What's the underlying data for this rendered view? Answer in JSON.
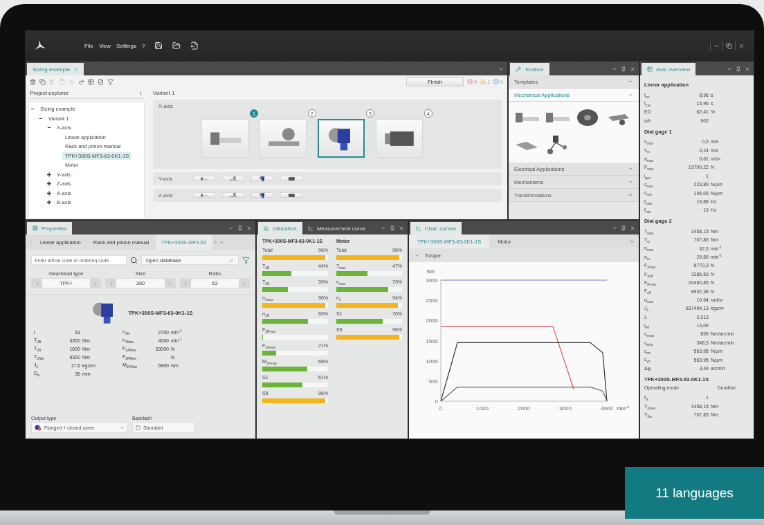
{
  "menu": [
    "File",
    "View",
    "Settings",
    "?"
  ],
  "sizing": {
    "tab": "Sizing example",
    "finish": "Finish",
    "counters": [
      {
        "kind": "error",
        "count": "0"
      },
      {
        "kind": "warning",
        "count": "1"
      },
      {
        "kind": "info",
        "count": "0"
      }
    ],
    "explorer_title": "Project explorer",
    "tree": [
      {
        "label": "Sizing example",
        "selected": false,
        "expanded": true,
        "children": [
          {
            "label": "Variant 1",
            "selected": false,
            "expanded": true,
            "children": [
              {
                "label": "X-axis",
                "selected": false,
                "expanded": true,
                "children": [
                  {
                    "label": "Linear application",
                    "selected": false
                  },
                  {
                    "label": "Rack and pinion manual",
                    "selected": false
                  },
                  {
                    "label": "TPK+300S-MF3-63-0K1-1S",
                    "selected": true
                  },
                  {
                    "label": "Motor",
                    "selected": false
                  }
                ]
              },
              {
                "label": "Y-axis",
                "selected": false,
                "expanded": false
              },
              {
                "label": "Z-axis",
                "selected": false,
                "expanded": false
              },
              {
                "label": "A-axis",
                "selected": false,
                "expanded": false
              },
              {
                "label": "B-axis",
                "selected": false,
                "expanded": false
              }
            ]
          }
        ]
      }
    ],
    "variant": "Variant 1",
    "axes": [
      {
        "label": "X-axis",
        "expanded": true,
        "components": [
          {
            "kind": "linear",
            "selected": false,
            "marker": "1",
            "marker_active": true
          },
          {
            "kind": "rack",
            "selected": false,
            "marker": "2",
            "marker_active": false
          },
          {
            "kind": "gearbox",
            "selected": true,
            "marker": "3",
            "marker_active": false
          },
          {
            "kind": "motor",
            "selected": false,
            "marker": "4",
            "marker_active": false
          }
        ]
      },
      {
        "label": "Y-axis",
        "expanded": false,
        "components": [
          {
            "kind": "linear",
            "selected": false
          },
          {
            "kind": "rack",
            "selected": false
          },
          {
            "kind": "gearbox",
            "selected": false
          },
          {
            "kind": "motor",
            "selected": false
          }
        ]
      },
      {
        "label": "Z-axis",
        "expanded": false,
        "components": [
          {
            "kind": "linear",
            "selected": false
          },
          {
            "kind": "rack",
            "selected": false
          },
          {
            "kind": "gearbox",
            "selected": false
          },
          {
            "kind": "motor",
            "selected": false
          }
        ]
      }
    ]
  },
  "toolbox": {
    "title": "Toolbox",
    "sections": [
      {
        "label": "Templates",
        "expanded": false
      },
      {
        "label": "Mechanical Applications",
        "expanded": true,
        "items": [
          {
            "kind": "linear"
          },
          {
            "kind": "linear"
          },
          {
            "kind": "fan"
          },
          {
            "kind": "arm"
          },
          {
            "kind": "chain"
          },
          {
            "kind": "network"
          }
        ]
      },
      {
        "label": "Electrical Applications",
        "expanded": false
      },
      {
        "label": "Mechanisms",
        "expanded": false
      },
      {
        "label": "Transformations",
        "expanded": false
      }
    ]
  },
  "properties": {
    "title": "Properties",
    "tabs": [
      {
        "label": "Linear application",
        "selected": false
      },
      {
        "label": "Rack and pinion manual",
        "selected": false
      },
      {
        "label": "TPK+300S-MF3-63",
        "selected": true
      }
    ],
    "search": {
      "placeholder": "Enter article code or ordering code"
    },
    "database": "Open database",
    "selectors": [
      {
        "label": "Gearhead type",
        "value": "TPK+"
      },
      {
        "label": "Size",
        "value": "300"
      },
      {
        "label": "Ratio",
        "value": "63"
      }
    ],
    "product": "TPK+300S-MF3-63-0K1-1S",
    "specs_left": [
      {
        "label": "i",
        "value": "63"
      },
      {
        "label": "T$_{2B}$",
        "value": "3300",
        "unit": "Nm"
      },
      {
        "label": "T$_{2N}$",
        "value": "1600",
        "unit": "Nm"
      },
      {
        "label": "T$_{2Not}$",
        "value": "6300",
        "unit": "Nm"
      },
      {
        "label": "J$_{1}$",
        "value": "17,6",
        "unit": "kgcm²"
      },
      {
        "label": "D$_{a}$",
        "value": "36",
        "unit": "mm"
      }
    ],
    "specs_right": [
      {
        "label": "n$_{1N}$",
        "value": "2700",
        "unit": "min$^{-1}$"
      },
      {
        "label": "n$_{1Max}$",
        "value": "4000",
        "unit": "min$^{-1}$"
      },
      {
        "label": "F$_{2AMax}$",
        "value": "33000",
        "unit": "N"
      },
      {
        "label": "F$_{2RMax}$",
        "unit": "N"
      },
      {
        "label": "M$_{2KMax}$",
        "value": "5900",
        "unit": "Nm"
      }
    ],
    "output_type": {
      "label": "Output type",
      "value": "Flanged + closed cover"
    },
    "backlash": {
      "label": "Backlash",
      "value": "Standard"
    }
  },
  "utilization": {
    "tabs": [
      {
        "label": "Utilization",
        "selected": true,
        "kind": "bars"
      },
      {
        "label": "Measurement curve",
        "selected": false,
        "kind": "curve"
      }
    ],
    "columns": [
      {
        "title": "TPK+300S-MF3-63-0K1-1S",
        "items": [
          {
            "label": "Total",
            "reading": "96%",
            "level": 0.96
          },
          {
            "label": "T$_{2B}$",
            "reading": "44%",
            "level": 0.44
          },
          {
            "label": "T$_{2N}$",
            "reading": "39%",
            "level": 0.39
          },
          {
            "label": "n$_{1max}$",
            "reading": "96%",
            "level": 0.96
          },
          {
            "label": "n$_{1N}$",
            "reading": "69%",
            "level": 0.69
          },
          {
            "label": "F$_{2Rmax}$",
            "level": 0
          },
          {
            "label": "F$_{2Amax}$",
            "reading": "21%",
            "level": 0.21
          },
          {
            "label": "M$_{2Kmax}$",
            "reading": "68%",
            "level": 0.68
          },
          {
            "label": "S1",
            "reading": "61%",
            "level": 0.61
          },
          {
            "label": "S5",
            "reading": "96%",
            "level": 0.96
          }
        ]
      },
      {
        "title": "Motor",
        "items": [
          {
            "label": "Total",
            "reading": "96%",
            "level": 0.96
          },
          {
            "label": "T$_{max}$",
            "reading": "47%",
            "level": 0.47
          },
          {
            "label": "n$_{max}$",
            "reading": "79%",
            "level": 0.79
          },
          {
            "label": "n$_{1}$",
            "reading": "94%",
            "level": 0.94
          },
          {
            "label": "S1",
            "reading": "70%",
            "level": 0.7
          },
          {
            "label": "S5",
            "reading": "96%",
            "level": 0.96
          }
        ]
      }
    ]
  },
  "curves": {
    "title": "Char. curves",
    "tabs": [
      {
        "label": "TPK+300S-MF3-63-0K1-1S",
        "selected": true
      },
      {
        "label": "Motor",
        "selected": false
      }
    ],
    "section": {
      "label": "Torque",
      "expanded": true
    },
    "chart_data": {
      "type": "line",
      "ylabel": "Nm",
      "xlabel": "min$^{-1}$",
      "x": [
        0,
        400,
        650,
        2700,
        3200,
        3600,
        3900,
        4000
      ],
      "series": [
        {
          "color": "#7b7bd6",
          "values": [
            3000,
            3000,
            3000,
            3000,
            3000,
            3000,
            3000,
            3000
          ]
        },
        {
          "color": "#e05050",
          "values": [
            1850,
            1850,
            1850,
            1850,
            300,
            null,
            null,
            null
          ]
        },
        {
          "color": "#333333",
          "values": [
            0,
            1450,
            1450,
            1450,
            1450,
            1450,
            1200,
            0
          ]
        },
        {
          "color": "#666666",
          "values": [
            0,
            350,
            350,
            350,
            350,
            350,
            250,
            0
          ]
        }
      ],
      "xlim": [
        0,
        4000
      ],
      "ylim": [
        0,
        3000
      ],
      "xticks": [
        0,
        1000,
        2000,
        3000,
        4000
      ],
      "yticks": [
        0,
        500,
        1000,
        1500,
        2000,
        2500,
        3000
      ]
    }
  },
  "overview": {
    "title": "Axis overview",
    "sections": [
      {
        "title": "Linear application",
        "rows": [
          {
            "label": "t$_{on}$",
            "value": "8,96",
            "unit": "s"
          },
          {
            "label": "t$_{cyc}$",
            "value": "15,96",
            "unit": "s"
          },
          {
            "label": "ED",
            "value": "62,41",
            "unit": "%"
          },
          {
            "label": "n/h",
            "value": "902"
          }
        ]
      },
      {
        "title": "Dial gage 1",
        "rows": [
          {
            "label": "v$_{max}$",
            "value": "0,5",
            "unit": "m/s"
          },
          {
            "label": "v$_{m}$",
            "value": "0,24",
            "unit": "m/s"
          },
          {
            "label": "a$_{max}$",
            "value": "0,61",
            "unit": "m/s²"
          },
          {
            "label": "F$_{max}$",
            "value": "19700,22",
            "unit": "N"
          },
          {
            "label": "i$_{ges}$",
            "value": "1"
          },
          {
            "label": "c$_{max}$",
            "value": "223,89",
            "unit": "N/µm"
          },
          {
            "label": "c$_{min}$",
            "value": "145,03",
            "unit": "N/µm"
          },
          {
            "label": "f$_{max}$",
            "value": "19,88",
            "unit": "Hz"
          },
          {
            "label": "f$_{min}$",
            "value": "16",
            "unit": "Hz"
          }
        ]
      },
      {
        "title": "Dial gage 2",
        "rows": [
          {
            "label": "T$_{max}$",
            "value": "1458,15",
            "unit": "Nm"
          },
          {
            "label": "T$_{m}$",
            "value": "707,83",
            "unit": "Nm"
          },
          {
            "label": "n$_{max}$",
            "value": "62,5",
            "unit": "min$^{-1}$"
          },
          {
            "label": "n$_{m}$",
            "value": "29,89",
            "unit": "min$^{-1}$"
          },
          {
            "label": "F$_{2max}$",
            "value": "6770,3",
            "unit": "N"
          },
          {
            "label": "F$_{2eff}$",
            "value": "3286,53",
            "unit": "N"
          },
          {
            "label": "F$_{Rmax}$",
            "value": "20460,85",
            "unit": "N"
          },
          {
            "label": "F$_{eff}$",
            "value": "8932,38",
            "unit": "N"
          },
          {
            "label": "α$_{max}$",
            "value": "10,64",
            "unit": "rad/s²"
          },
          {
            "label": "J$_{L}$",
            "value": "837494,13",
            "unit": "kgcm²"
          },
          {
            "label": "λ",
            "value": "2,013"
          },
          {
            "label": "i$_{eff}$",
            "value": "13,09"
          },
          {
            "label": "c$_{tmax}$",
            "value": "899",
            "unit": "Nm/arcmin"
          },
          {
            "label": "c$_{tmin}$",
            "value": "348,5",
            "unit": "Nm/arcmin"
          },
          {
            "label": "c$_{xz}$",
            "value": "563,95",
            "unit": "N/µm"
          },
          {
            "label": "c$_{yz}$",
            "value": "563,95",
            "unit": "N/µm"
          },
          {
            "label": "Δφ",
            "value": "3,44",
            "unit": "arcmin"
          }
        ]
      },
      {
        "title": "TPK+300S-MF3-63-0K1-1S",
        "head": [
          "Operating mode",
          "Duration"
        ],
        "rows": [
          {
            "label": "f$_{S}$",
            "value": "1"
          },
          {
            "label": "T$_{2max}$",
            "value": "1458,15",
            "unit": "Nm"
          },
          {
            "label": "T$_{2m}$",
            "value": "707,83",
            "unit": "Nm"
          }
        ]
      }
    ]
  },
  "badge": "11 languages"
}
